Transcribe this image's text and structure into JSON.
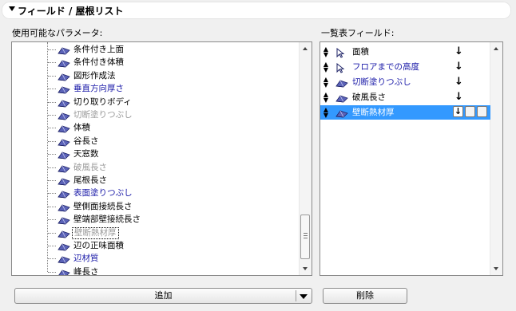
{
  "header": {
    "title": "フィールド /  屋根リスト"
  },
  "left_panel": {
    "label": "使用可能なパラメータ:",
    "items": [
      {
        "label": "条件付き上面",
        "color": "black",
        "selected": false
      },
      {
        "label": "条件付き体積",
        "color": "black",
        "selected": false
      },
      {
        "label": "図形作成法",
        "color": "black",
        "selected": false
      },
      {
        "label": "垂直方向厚さ",
        "color": "blue",
        "selected": false
      },
      {
        "label": "切り取りボディ",
        "color": "black",
        "selected": false
      },
      {
        "label": "切断塗りつぶし",
        "color": "gray",
        "selected": false
      },
      {
        "label": "体積",
        "color": "black",
        "selected": false
      },
      {
        "label": "谷長さ",
        "color": "black",
        "selected": false
      },
      {
        "label": "天窓数",
        "color": "black",
        "selected": false
      },
      {
        "label": "破風長さ",
        "color": "gray",
        "selected": false
      },
      {
        "label": "尾根長さ",
        "color": "black",
        "selected": false
      },
      {
        "label": "表面塗りつぶし",
        "color": "blue",
        "selected": false
      },
      {
        "label": "壁側面接続長さ",
        "color": "black",
        "selected": false
      },
      {
        "label": "壁端部壁接続長さ",
        "color": "black",
        "selected": false
      },
      {
        "label": "壁断熱材厚",
        "color": "gray",
        "selected": true
      },
      {
        "label": "辺の正味面積",
        "color": "black",
        "selected": false
      },
      {
        "label": "辺材質",
        "color": "blue",
        "selected": false
      },
      {
        "label": "峰長さ",
        "color": "black",
        "selected": false
      }
    ]
  },
  "right_panel": {
    "label": "一覧表フィールド:",
    "rows": [
      {
        "label": "面積",
        "icon": "pointer-icon",
        "color": "black",
        "sort": "↓",
        "selected": false
      },
      {
        "label": "フロアまでの高度",
        "icon": "pointer-icon",
        "color": "blue",
        "sort": "↓",
        "selected": false
      },
      {
        "label": "切断塗りつぶし",
        "icon": "roof-icon",
        "color": "blue",
        "sort": "↓",
        "selected": false
      },
      {
        "label": "破風長さ",
        "icon": "roof-icon",
        "color": "black",
        "sort": "↓",
        "selected": false
      },
      {
        "label": "壁断熱材厚",
        "icon": "roof-icon",
        "color": "white",
        "sort": "↓",
        "selected": true
      }
    ],
    "updown_glyph": "⬍"
  },
  "buttons": {
    "add": "追加",
    "remove": "削除"
  },
  "colors": {
    "selection": "#3399ff",
    "blue_text": "#1a1aa8",
    "gray_text": "#9a9a9a"
  }
}
